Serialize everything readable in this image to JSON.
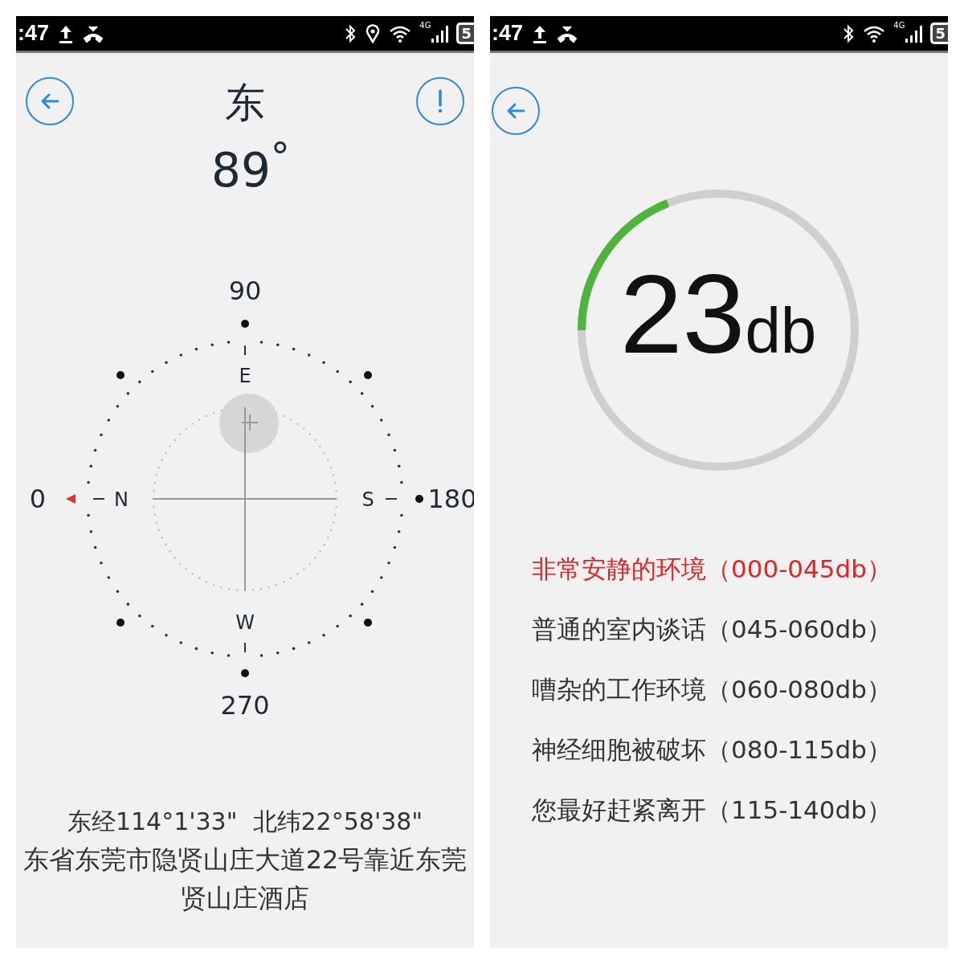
{
  "compass_screen": {
    "status_bar": {
      "time": ":47",
      "network": "4G",
      "battery": "5"
    },
    "direction": "东",
    "degrees": "89$^{°}$",
    "compass": {
      "top_label": "90",
      "left_label": "0",
      "right_label": "180",
      "bottom_label": "270",
      "east": "E",
      "north": "N",
      "south": "S",
      "west": "W"
    },
    "coordinates": "东经114°1'33\"  北纬22°58'38\"",
    "address_lines": [
      "东省东莞市隐贤山庄大道22号靠近东莞",
      "贤山庄酒店"
    ]
  },
  "noise_screen": {
    "status_bar": {
      "time": ":47",
      "network": "4G",
      "battery": "5"
    },
    "gauge": {
      "reading": "23",
      "unit": "db"
    },
    "levels": [
      {
        "text": "非常安静的环境（000-045db）",
        "selected": true
      },
      {
        "text": "普通的室内谈话（045-060db）",
        "selected": false
      },
      {
        "text": "嘈杂的工作环境（060-080db）",
        "selected": false
      },
      {
        "text": "神经细胞被破坏（080-115db）",
        "selected": false
      },
      {
        "text": "您最好赶紧离开（115-140db）",
        "selected": false
      }
    ]
  }
}
